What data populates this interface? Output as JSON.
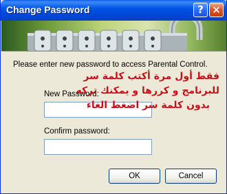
{
  "window": {
    "title": "Change Password",
    "help_glyph": "?",
    "close_glyph": "×"
  },
  "banner": {
    "icon": "padlock-combination-image"
  },
  "dialog": {
    "instruction": "Please enter new password to access Parental Control.",
    "new_password_label": "New Password:",
    "new_password_value": "",
    "confirm_password_label": "Confirm password:",
    "confirm_password_value": "",
    "ok_label": "OK",
    "cancel_label": "Cancel"
  },
  "annotation": {
    "color": "#c8101a",
    "line1": "فقط أول مرة أكتب كلمة سر",
    "line2": "للبرنامج و كررها و يمكنك تركه",
    "line3": "بدون كلمة سر اضغط الغاء"
  },
  "colors": {
    "titlebar": "#0055e5",
    "window_bg": "#ece9d8",
    "field_border": "#7f9db9"
  }
}
